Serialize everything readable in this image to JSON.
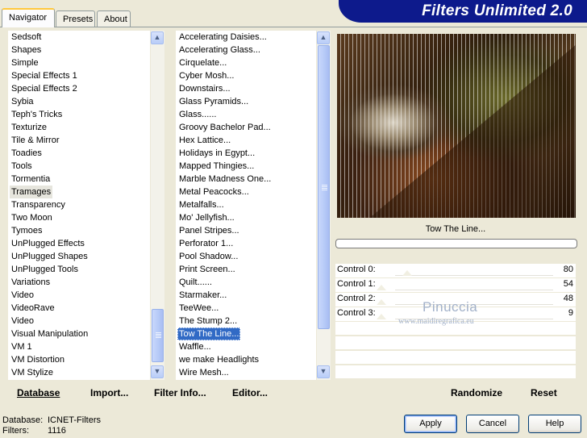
{
  "app": {
    "title": "Filters Unlimited 2.0"
  },
  "tabs": [
    {
      "label": "Navigator",
      "active": true
    },
    {
      "label": "Presets",
      "active": false
    },
    {
      "label": "About",
      "active": false
    }
  ],
  "categories": {
    "items": [
      "Sedsoft",
      "Shapes",
      "Simple",
      "Special Effects 1",
      "Special Effects 2",
      "Sybia",
      "Teph's Tricks",
      "Texturize",
      "Tile & Mirror",
      "Toadies",
      "Tools",
      "Tormentia",
      "Tramages",
      "Transparency",
      "Two Moon",
      "Tymoes",
      "UnPlugged Effects",
      "UnPlugged Shapes",
      "UnPlugged Tools",
      "Variations",
      "Video",
      "VideoRave",
      "Video",
      "Visual Manipulation",
      "VM 1",
      "VM Distortion",
      "VM Stylize"
    ],
    "selected": "Tramages"
  },
  "filters": {
    "items": [
      "Accelerating Daisies...",
      "Accelerating Glass...",
      "Cirquelate...",
      "Cyber Mosh...",
      "Downstairs...",
      "Glass Pyramids...",
      "Glass......",
      "Groovy Bachelor Pad...",
      "Hex Lattice...",
      "Holidays in Egypt...",
      "Mapped Thingies...",
      "Marble Madness One...",
      "Metal Peacocks...",
      "Metalfalls...",
      "Mo' Jellyfish...",
      "Panel Stripes...",
      "Perforator 1...",
      "Pool Shadow...",
      "Print Screen...",
      "Quilt......",
      "Starmaker...",
      "TeeWee...",
      "The Stump 2...",
      "Tow The Line...",
      "Waffle...",
      "we make Headlights",
      "Wire Mesh..."
    ],
    "selected": "Tow The Line..."
  },
  "preview": {
    "filter_name": "Tow The Line..."
  },
  "controls": [
    {
      "label": "Control 0:",
      "value": "80"
    },
    {
      "label": "Control 1:",
      "value": "54"
    },
    {
      "label": "Control 2:",
      "value": "48"
    },
    {
      "label": "Control 3:",
      "value": "9"
    }
  ],
  "watermark": {
    "name": "Pinuccia",
    "site": "www.maidiregrafica.eu"
  },
  "bottom_bar": {
    "database": "Database",
    "import": "Import...",
    "filter_info": "Filter Info...",
    "editor": "Editor...",
    "randomize": "Randomize",
    "reset": "Reset"
  },
  "status": {
    "database_label": "Database:",
    "database_value": "ICNET-Filters",
    "filters_label": "Filters:",
    "filters_value": "1116"
  },
  "dialog_buttons": {
    "apply": "Apply",
    "cancel": "Cancel",
    "help": "Help"
  },
  "colors": {
    "banner": "#0d1a8c",
    "selection": "#316ac5",
    "face": "#ece9d8"
  }
}
